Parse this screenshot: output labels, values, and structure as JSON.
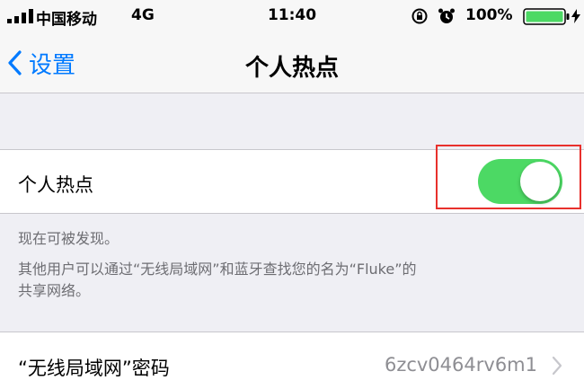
{
  "status_bar": {
    "carrier": "中国移动",
    "network": "4G",
    "time": "11:40",
    "battery": "100%",
    "icons": [
      "signal-icon",
      "lock-rotation-icon",
      "alarm-icon",
      "battery-icon",
      "charging-icon"
    ]
  },
  "nav": {
    "back_label": "设置",
    "title": "个人热点"
  },
  "hotspot": {
    "label": "个人热点",
    "enabled": true
  },
  "footer": {
    "line1": "现在可被发现。",
    "line2": "其他用户可以通过“无线局域网”和蓝牙查找您的名为“Fluke”的",
    "line3": "共享网络。"
  },
  "wifi_password": {
    "label": "“无线局域网”密码",
    "value": "6zcv0464rv6m1"
  },
  "colors": {
    "accent": "#007aff",
    "toggle_on": "#4cd964",
    "highlight": "#e8302c",
    "background": "#efeff4"
  }
}
